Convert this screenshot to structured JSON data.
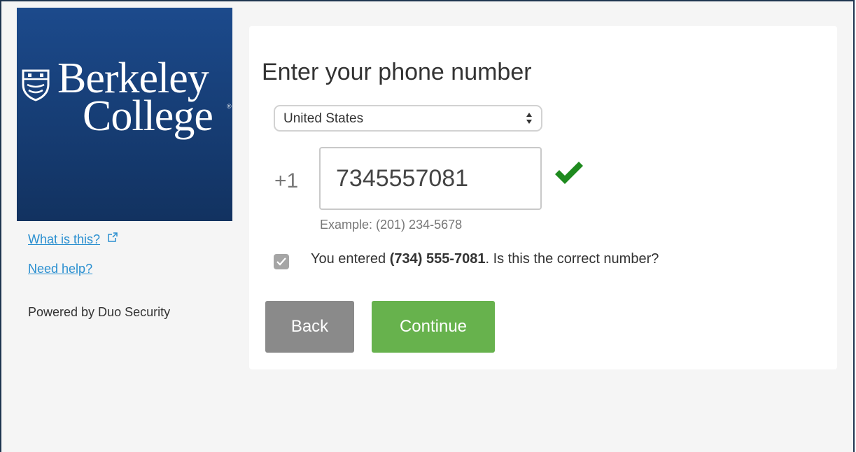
{
  "logo": {
    "line1": "Berkeley",
    "line2": "College",
    "reg_mark": "®"
  },
  "sidebar": {
    "what_is_this": "What is this?",
    "need_help": "Need help?",
    "powered_by": "Powered by Duo Security"
  },
  "form": {
    "title": "Enter your phone number",
    "country": "United States",
    "country_code": "+1",
    "phone_value": "7345557081",
    "example": "Example: (201) 234-5678",
    "confirm_prefix": "You entered ",
    "confirm_number": "(734) 555-7081",
    "confirm_suffix": ". Is this the correct number?",
    "confirm_checked": true
  },
  "buttons": {
    "back": "Back",
    "continue": "Continue"
  },
  "colors": {
    "logo_bg": "#173f78",
    "link": "#2a8fd0",
    "back_button": "#8a8a8a",
    "continue_button": "#67b24d",
    "check": "#1e8a1e"
  },
  "icons": {
    "shield": "shield-icon",
    "external_link": "external-link-icon",
    "select_arrows": "select-arrows-icon",
    "valid": "checkmark-icon",
    "checkbox": "checkbox-checked-icon"
  }
}
